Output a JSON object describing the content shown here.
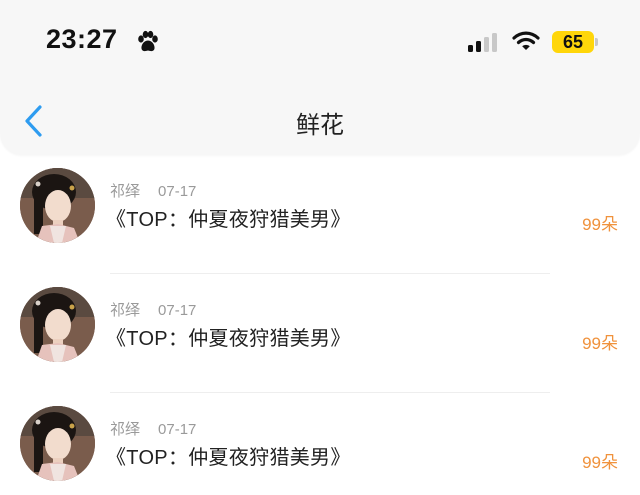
{
  "status_bar": {
    "time": "23:27",
    "battery": "65"
  },
  "nav": {
    "title": "鲜花"
  },
  "gifts": [
    {
      "user": "祁绎",
      "date": "07-17",
      "work": "《TOP：仲夏夜狩猎美男》",
      "amount": "99朵"
    },
    {
      "user": "祁绎",
      "date": "07-17",
      "work": "《TOP：仲夏夜狩猎美男》",
      "amount": "99朵"
    },
    {
      "user": "祁绎",
      "date": "07-17",
      "work": "《TOP：仲夏夜狩猎美男》",
      "amount": "99朵"
    }
  ],
  "colors": {
    "accent": "#f0923c",
    "back_arrow": "#2e9cf0",
    "battery": "#ffd60a"
  }
}
